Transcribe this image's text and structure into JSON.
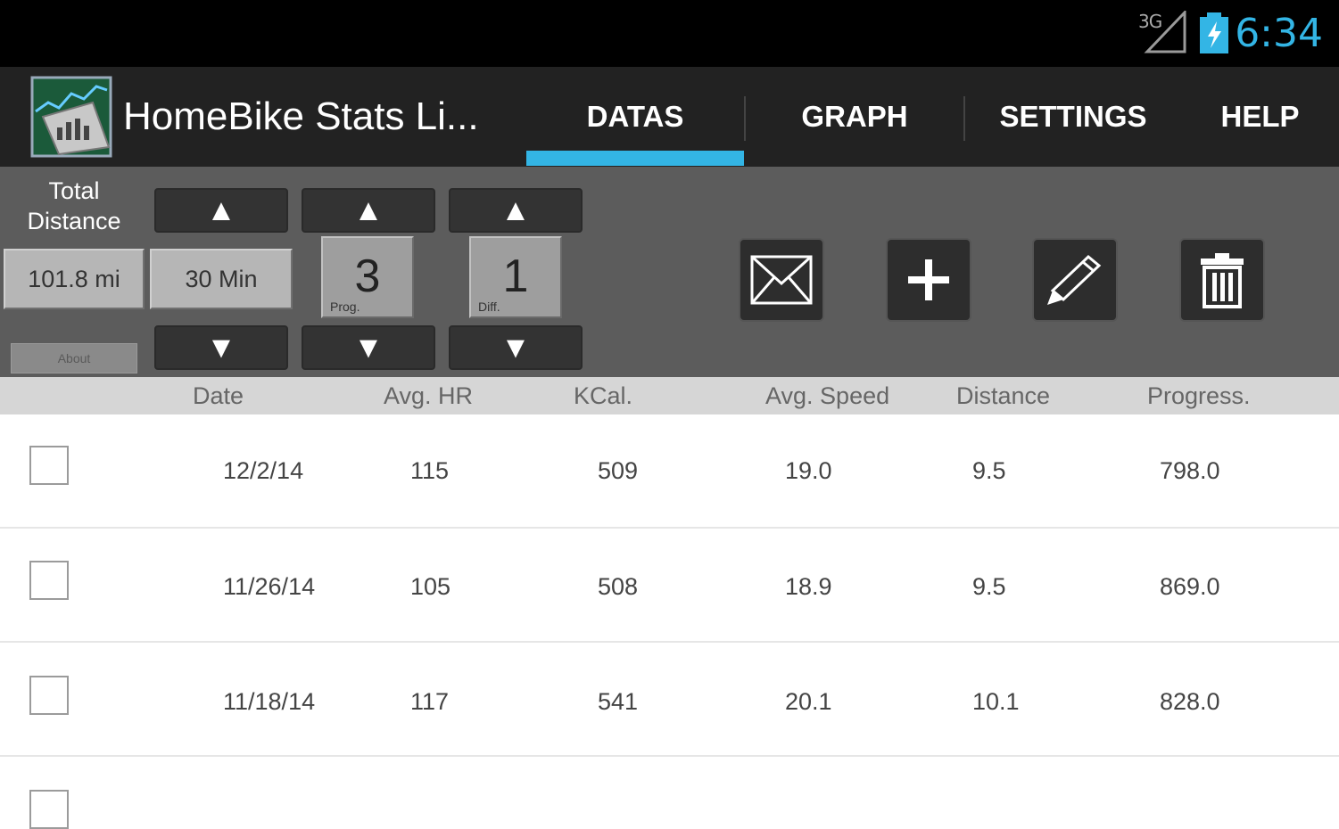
{
  "status_bar": {
    "network": "3G",
    "time": "6:34"
  },
  "app": {
    "title": "HomeBike Stats Li..."
  },
  "tabs": [
    {
      "label": "DATAS",
      "selected": true
    },
    {
      "label": "GRAPH",
      "selected": false
    },
    {
      "label": "SETTINGS",
      "selected": false
    },
    {
      "label": "HELP",
      "selected": false
    }
  ],
  "controls": {
    "total_label": "Total\nDistance",
    "distance_value": "101.8 mi",
    "duration_value": "30 Min",
    "small_label": "About",
    "prog_value": "3",
    "prog_label": "Prog.",
    "diff_value": "1",
    "diff_label": "Diff.",
    "up_arrow": "▲",
    "down_arrow": "▼"
  },
  "table": {
    "headers": [
      "Date",
      "Avg. HR",
      "KCal.",
      "Avg. Speed",
      "Distance",
      "Progress."
    ],
    "rows": [
      {
        "date": "12/2/14",
        "avg_hr": "115",
        "kcal": "509",
        "avg_speed": "19.0",
        "distance": "9.5",
        "progress": "798.0",
        "checked": false
      },
      {
        "date": "11/26/14",
        "avg_hr": "105",
        "kcal": "508",
        "avg_speed": "18.9",
        "distance": "9.5",
        "progress": "869.0",
        "checked": false
      },
      {
        "date": "11/18/14",
        "avg_hr": "117",
        "kcal": "541",
        "avg_speed": "20.1",
        "distance": "10.1",
        "progress": "828.0",
        "checked": false
      }
    ]
  },
  "colors": {
    "accent": "#33b5e5",
    "actionbar": "#222222",
    "panel": "#5c5c5c"
  },
  "icons": [
    "signal-3g-icon",
    "battery-charging-icon",
    "app-logo-icon",
    "mail-icon",
    "plus-icon",
    "pencil-icon",
    "trash-icon"
  ]
}
